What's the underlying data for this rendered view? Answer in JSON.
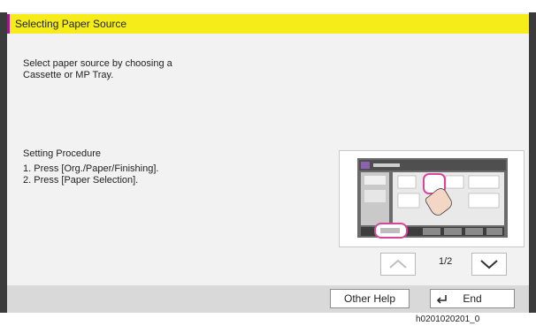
{
  "title": "Selecting Paper Source",
  "description_line1": "Select paper source by choosing a",
  "description_line2": "Cassette or MP Tray.",
  "procedure": {
    "heading": "Setting Procedure",
    "step1": "1. Press [Org./Paper/Finishing].",
    "step2": "2. Press [Paper Selection]."
  },
  "pager": {
    "current": "1/2",
    "up_icon": "chevron-up-icon",
    "down_icon": "chevron-down-icon"
  },
  "buttons": {
    "other_help": "Other Help",
    "end": "End",
    "end_icon": "return-arrow-icon"
  },
  "footer_code": "h0201020201_0",
  "colors": {
    "title_bg": "#f5ec1a",
    "accent": "#a0178a",
    "highlight": "#d6479c"
  }
}
